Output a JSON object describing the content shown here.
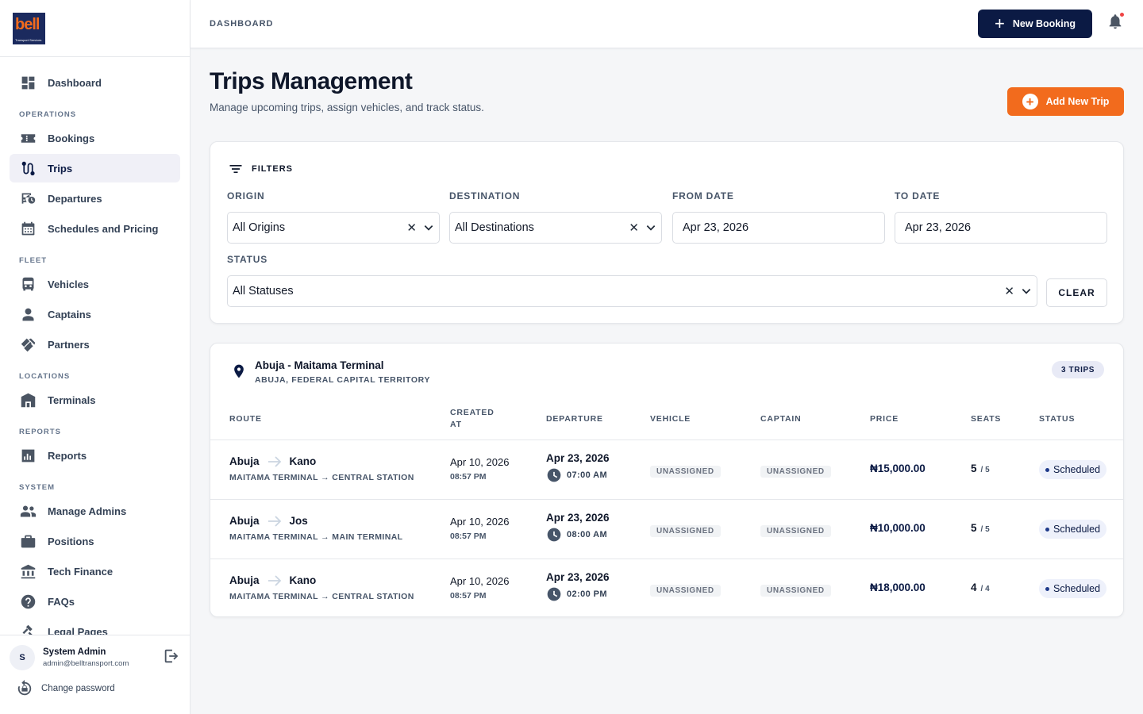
{
  "brand": {
    "logo_word": "bell",
    "logo_sub": "Transport Services"
  },
  "sidebar": {
    "top_items": [
      {
        "label": "Dashboard",
        "icon": "dashboard-icon"
      }
    ],
    "sections": [
      {
        "title": "OPERATIONS",
        "items": [
          {
            "label": "Bookings",
            "icon": "ticket-icon"
          },
          {
            "label": "Trips",
            "icon": "route-icon",
            "active": true
          },
          {
            "label": "Departures",
            "icon": "bus-clock-icon"
          },
          {
            "label": "Schedules and Pricing",
            "icon": "calendar-icon"
          }
        ]
      },
      {
        "title": "FLEET",
        "items": [
          {
            "label": "Vehicles",
            "icon": "bus-icon"
          },
          {
            "label": "Captains",
            "icon": "person-icon"
          },
          {
            "label": "Partners",
            "icon": "handshake-icon"
          }
        ]
      },
      {
        "title": "LOCATIONS",
        "items": [
          {
            "label": "Terminals",
            "icon": "warehouse-icon"
          }
        ]
      },
      {
        "title": "REPORTS",
        "items": [
          {
            "label": "Reports",
            "icon": "bar-chart-icon"
          }
        ]
      },
      {
        "title": "SYSTEM",
        "items": [
          {
            "label": "Manage Admins",
            "icon": "people-icon"
          },
          {
            "label": "Positions",
            "icon": "briefcase-icon"
          },
          {
            "label": "Tech Finance",
            "icon": "bank-icon"
          },
          {
            "label": "FAQs",
            "icon": "help-icon"
          },
          {
            "label": "Legal Pages",
            "icon": "gavel-icon"
          }
        ]
      }
    ]
  },
  "user": {
    "initial": "S",
    "name": "System Admin",
    "email": "admin@belltransport.com",
    "change_password": "Change password"
  },
  "header": {
    "breadcrumb": "DASHBOARD",
    "new_booking": "New Booking"
  },
  "page": {
    "title": "Trips Management",
    "subtitle": "Manage upcoming trips, assign vehicles, and track status.",
    "add_trip": "Add New Trip"
  },
  "filters": {
    "title": "FILTERS",
    "origin_label": "ORIGIN",
    "origin_value": "All Origins",
    "destination_label": "DESTINATION",
    "destination_value": "All Destinations",
    "from_label": "FROM DATE",
    "from_value": "Apr 23, 2026",
    "to_label": "TO DATE",
    "to_value": "Apr 23, 2026",
    "status_label": "STATUS",
    "status_value": "All Statuses",
    "clear": "CLEAR"
  },
  "terminal": {
    "name": "Abuja - Maitama Terminal",
    "location": "ABUJA, FEDERAL CAPITAL TERRITORY",
    "count": "3 TRIPS",
    "columns": {
      "route": "ROUTE",
      "created": "CREATED AT",
      "departure": "DEPARTURE",
      "vehicle": "VEHICLE",
      "captain": "CAPTAIN",
      "price": "PRICE",
      "seats": "SEATS",
      "status": "STATUS"
    },
    "rows": [
      {
        "from": "Abuja",
        "to": "Kano",
        "terminals": "MAITAMA TERMINAL → CENTRAL STATION",
        "created_date": "Apr 10, 2026",
        "created_time": "08:57 PM",
        "dep_date": "Apr 23, 2026",
        "dep_time": "07:00 AM",
        "vehicle": "UNASSIGNED",
        "captain": "UNASSIGNED",
        "price": "₦15,000.00",
        "seats": "5",
        "seats_total": "/ 5",
        "status": "Scheduled"
      },
      {
        "from": "Abuja",
        "to": "Jos",
        "terminals": "MAITAMA TERMINAL → MAIN TERMINAL",
        "created_date": "Apr 10, 2026",
        "created_time": "08:57 PM",
        "dep_date": "Apr 23, 2026",
        "dep_time": "08:00 AM",
        "vehicle": "UNASSIGNED",
        "captain": "UNASSIGNED",
        "price": "₦10,000.00",
        "seats": "5",
        "seats_total": "/ 5",
        "status": "Scheduled"
      },
      {
        "from": "Abuja",
        "to": "Kano",
        "terminals": "MAITAMA TERMINAL → CENTRAL STATION",
        "created_date": "Apr 10, 2026",
        "created_time": "08:57 PM",
        "dep_date": "Apr 23, 2026",
        "dep_time": "02:00 PM",
        "vehicle": "UNASSIGNED",
        "captain": "UNASSIGNED",
        "price": "₦18,000.00",
        "seats": "4",
        "seats_total": "/ 4",
        "status": "Scheduled"
      }
    ]
  },
  "colors": {
    "primary": "#0b1a44",
    "accent": "#f26b1d",
    "notification": "#ef4444"
  }
}
